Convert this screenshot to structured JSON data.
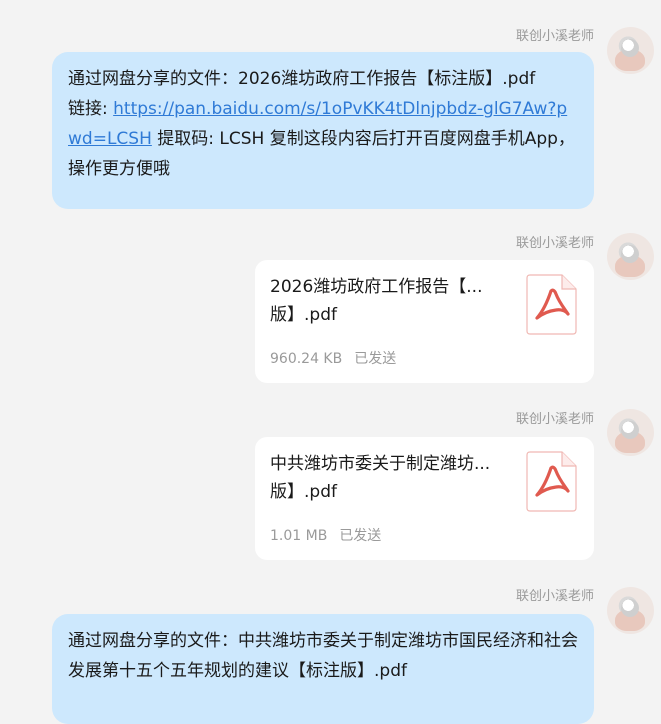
{
  "sender_name": "联创小溪老师",
  "colors": {
    "bubble": "#cde8fd",
    "link": "#2f7ad6",
    "pdf_red": "#e05a4f",
    "meta": "#9a9a9a"
  },
  "messages": [
    {
      "type": "text",
      "prefix": "通过网盘分享的文件：2026潍坊政府工作报告【标注版】.pdf",
      "link_label": "链接: ",
      "link": "https://pan.baidu.com/s/1oPvKK4tDlnjpbdz-glG7Aw?pwd=LCSH",
      "suffix": " 提取码: LCSH 复制这段内容后打开百度网盘手机App，操作更方便哦"
    },
    {
      "type": "file",
      "name": "2026潍坊政府工作报告【...",
      "name_line2": "版】.pdf",
      "size": "960.24 KB",
      "status": "已发送",
      "icon": "pdf-file-icon"
    },
    {
      "type": "file",
      "name": "中共潍坊市委关于制定潍坊...",
      "name_line2": "版】.pdf",
      "size": "1.01 MB",
      "status": "已发送",
      "icon": "pdf-file-icon"
    },
    {
      "type": "text",
      "prefix": "通过网盘分享的文件：中共潍坊市委关于制定潍坊市国民经济和社会发展第十五个五年规划的建议【标注版】.pdf"
    }
  ]
}
